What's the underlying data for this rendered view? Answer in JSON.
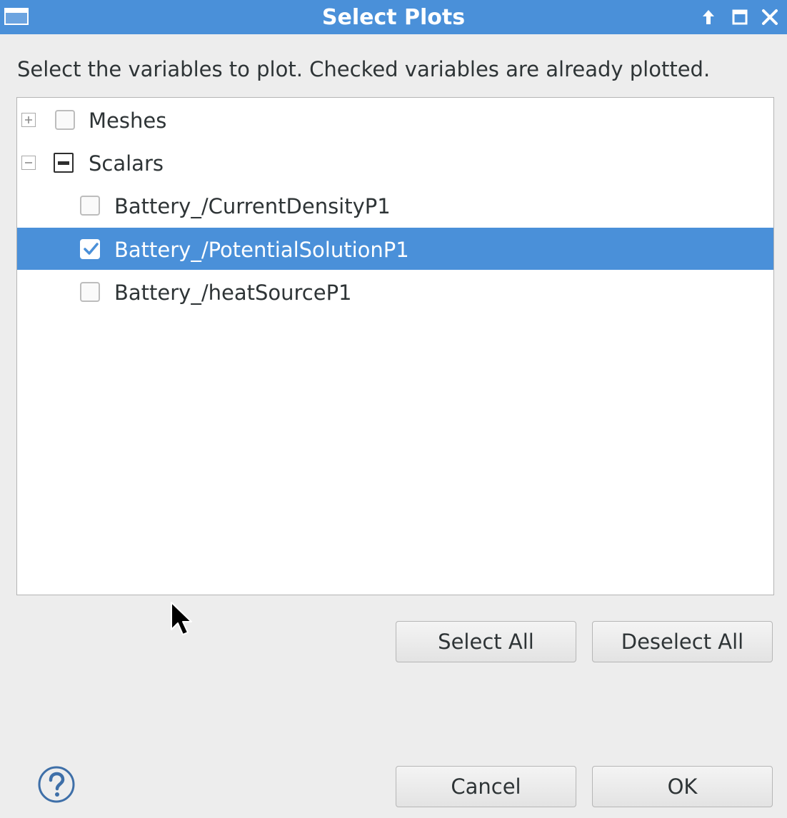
{
  "window": {
    "title": "Select Plots"
  },
  "instruction": "Select the variables to plot. Checked variables are already plotted.",
  "tree": {
    "meshes": {
      "label": "Meshes",
      "expanded": false,
      "check_state": "unchecked"
    },
    "scalars": {
      "label": "Scalars",
      "expanded": true,
      "check_state": "mixed",
      "children": [
        {
          "label": "Battery_/CurrentDensityP1",
          "checked": false,
          "selected": false
        },
        {
          "label": "Battery_/PotentialSolutionP1",
          "checked": true,
          "selected": true
        },
        {
          "label": "Battery_/heatSourceP1",
          "checked": false,
          "selected": false
        }
      ]
    }
  },
  "buttons": {
    "select_all": "Select All",
    "deselect_all": "Deselect All",
    "cancel": "Cancel",
    "ok": "OK"
  },
  "colors": {
    "titlebar": "#4a90d9",
    "selection": "#4a90d9",
    "background": "#ededed"
  },
  "icons": [
    "window-menu-icon",
    "up-arrow-icon",
    "maximize-icon",
    "close-icon",
    "expand-plus-icon",
    "collapse-minus-icon",
    "help-icon",
    "mouse-pointer-icon"
  ]
}
